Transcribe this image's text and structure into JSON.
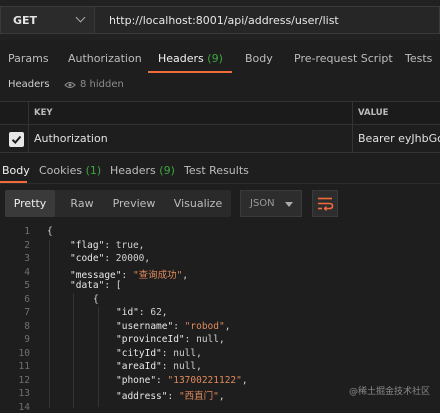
{
  "request": {
    "method": "GET",
    "url": "http://localhost:8001/api/address/user/list"
  },
  "request_tabs": [
    {
      "label": "Params"
    },
    {
      "label": "Authorization"
    },
    {
      "label": "Headers",
      "count": "(9)",
      "active": true
    },
    {
      "label": "Body"
    },
    {
      "label": "Pre-request Script"
    },
    {
      "label": "Tests"
    }
  ],
  "headers_section": {
    "title": "Headers",
    "hidden_text": "8 hidden"
  },
  "table": {
    "col_key": "KEY",
    "col_value": "VALUE",
    "rows": [
      {
        "key": "Authorization",
        "value": "Bearer eyJhbGciOi",
        "checked": true
      }
    ]
  },
  "response_tabs": [
    {
      "label": "Body",
      "active": true
    },
    {
      "label": "Cookies",
      "count": "(1)"
    },
    {
      "label": "Headers",
      "count": "(9)"
    },
    {
      "label": "Test Results"
    }
  ],
  "toolbar": {
    "formats": [
      "Pretty",
      "Raw",
      "Preview",
      "Visualize"
    ],
    "selected": "Pretty",
    "language": "JSON"
  },
  "code_lines": [
    "1",
    "2",
    "3",
    "4",
    "5",
    "6",
    "7",
    "8",
    "9",
    "10",
    "11",
    "12",
    "13",
    "14"
  ],
  "json": {
    "flag_key": "\"flag\"",
    "flag_val": "true",
    "code_key": "\"code\"",
    "code_val": "20000",
    "message_key": "\"message\"",
    "message_val": "\"查询成功\"",
    "data_key": "\"data\"",
    "id_key": "\"id\"",
    "id_val": "62",
    "username_key": "\"username\"",
    "username_val": "\"robod\"",
    "provinceId_key": "\"provinceId\"",
    "provinceId_val": "null",
    "cityId_key": "\"cityId\"",
    "cityId_val": "null",
    "areaId_key": "\"areaId\"",
    "areaId_val": "null",
    "phone_key": "\"phone\"",
    "phone_val": "\"13700221122\"",
    "address_key": "\"address\"",
    "address_val": "\"西直门\""
  },
  "watermark": "@稀土掘金技术社区",
  "colors": {
    "accent": "#f26b3a",
    "count_green": "#3fa53f",
    "string_orange": "#e08a5c",
    "background": "#1e1e1e"
  }
}
